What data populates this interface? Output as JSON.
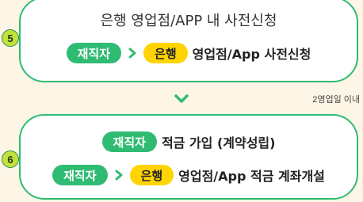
{
  "step5": {
    "number": "5",
    "title": "은행 영업점/APP 내 사전신청",
    "tag": "재직자",
    "bank_tag": "은행",
    "text": "영업점/App 사전신청"
  },
  "note": "2영업일 이내",
  "step6": {
    "number": "6",
    "top_tag": "재직자",
    "top_text": "적금 가입 (계약성립)",
    "tag": "재직자",
    "bank_tag": "은행",
    "text": "영업점/App 적금 계좌개설"
  },
  "colors": {
    "green": "#2fbb72",
    "yellow": "#ffd400",
    "badge": "#c4e13a",
    "background": "#fdf6e6"
  },
  "icons": [
    "chevron-right-icon",
    "chevron-down-icon"
  ]
}
